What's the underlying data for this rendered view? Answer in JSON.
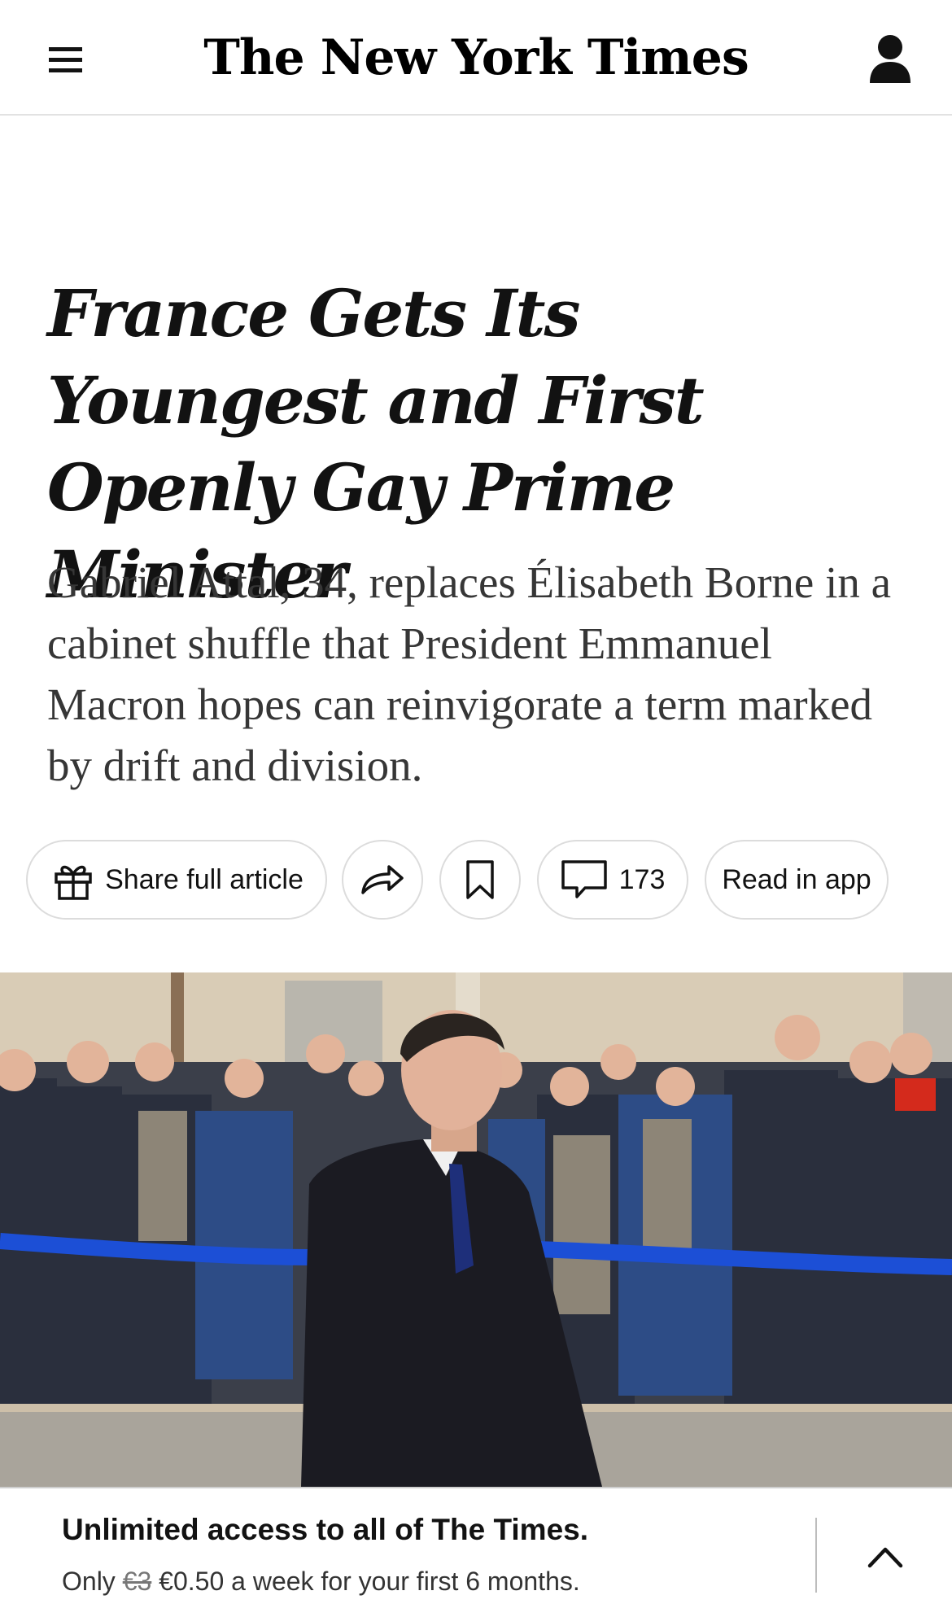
{
  "header": {
    "masthead": "The New York Times",
    "menu_icon": "hamburger-menu-icon",
    "account_icon": "person-icon"
  },
  "article": {
    "headline": "France Gets Its Youngest and First Openly Gay Prime Minister",
    "summary": "Gabriel Attal, 34, replaces Élisabeth Borne in a cabinet shuffle that President Emmanuel Macron hopes can reinvigorate a term marked by drift and division."
  },
  "actions": {
    "share_full_label": "Share full article",
    "share_full_icon": "gift-icon",
    "forward_icon": "share-arrow-icon",
    "save_icon": "bookmark-icon",
    "comments_icon": "comment-icon",
    "comments_count": "173",
    "read_in_app_label": "Read in app"
  },
  "banner": {
    "title": "Unlimited access to all of The Times.",
    "offer_prefix": "Only",
    "old_price": "€3",
    "offer_rest": "€0.50 a week for your first 6 months.",
    "toggle_icon": "chevron-up-icon"
  },
  "colors": {
    "text": "#121212",
    "summary_text": "#363636",
    "border": "#dcdcdc",
    "rope_blue": "#1c4fd6",
    "scarf_red": "#d42a1c"
  }
}
